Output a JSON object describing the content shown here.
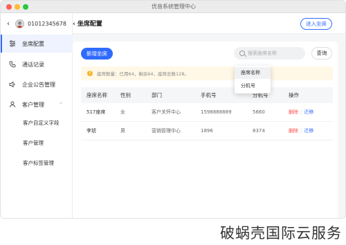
{
  "window": {
    "title": "优音系统管理中心"
  },
  "user": {
    "phone": "01012345678"
  },
  "sidebar": {
    "items": [
      {
        "label": "坐席配置",
        "icon": "sliders-icon"
      },
      {
        "label": "通话记录",
        "icon": "phone-icon"
      },
      {
        "label": "企业公告管理",
        "icon": "speaker-icon"
      },
      {
        "label": "客户管理",
        "icon": "user-icon"
      }
    ],
    "sub_items": [
      {
        "label": "客户自定义字段"
      },
      {
        "label": "客户管理"
      },
      {
        "label": "客户标签管理"
      }
    ]
  },
  "header": {
    "title": "坐席配置",
    "enter_button": "进入坐席"
  },
  "toolbar": {
    "add_button": "新增坐席",
    "search_placeholder": "搜索座席名称",
    "query_button": "查询"
  },
  "notice": {
    "text": "座席数量：已用64，剩余64，座席总数128。"
  },
  "dropdown": {
    "options": [
      "座席名称",
      "分机号"
    ],
    "selected": "座席名称"
  },
  "table": {
    "headers": [
      "座席名称",
      "性别",
      "部门",
      "手机号",
      "分机号",
      "操作"
    ],
    "rows": [
      {
        "name": "517座席",
        "gender": "女",
        "dept": "客户关怀中心",
        "mobile": "1598888889",
        "ext": "5660"
      },
      {
        "name": "李琥",
        "gender": "男",
        "dept": "营销管理中心",
        "mobile": "1896",
        "ext": "8374"
      }
    ],
    "actions": {
      "delete": "删除",
      "move": "迁移"
    }
  },
  "watermark": "破蜗壳国际云服务",
  "colors": {
    "accent": "#2f6bff",
    "danger": "#ff4d4f",
    "warning": "#f6b32e"
  }
}
